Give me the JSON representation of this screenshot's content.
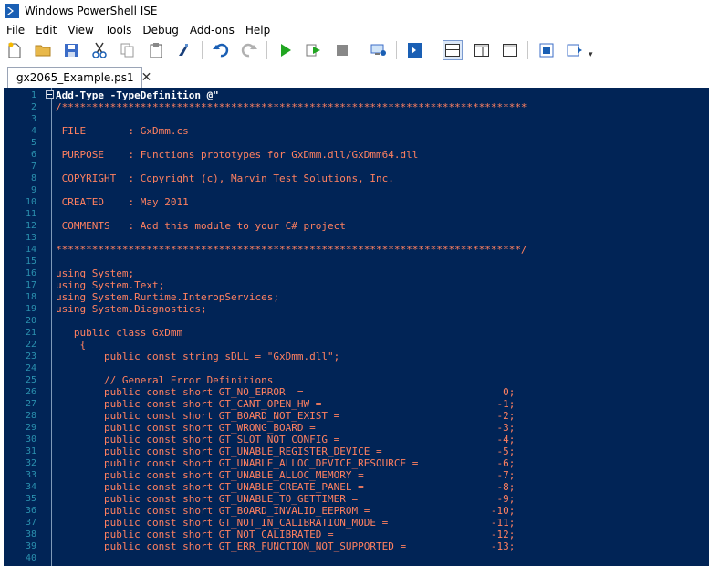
{
  "window": {
    "title": "Windows PowerShell ISE"
  },
  "menu": [
    "File",
    "Edit",
    "View",
    "Tools",
    "Debug",
    "Add-ons",
    "Help"
  ],
  "toolbar_icons": [
    "new-file-icon",
    "open-folder-icon",
    "save-icon",
    "cut-icon",
    "copy-icon",
    "paste-icon",
    "clear-console-icon",
    "undo-icon",
    "redo-icon",
    "run-script-icon",
    "run-selection-icon",
    "stop-icon",
    "new-remote-tab-icon",
    "start-powershell-icon",
    "show-script-pane-top-icon",
    "show-script-pane-right-icon",
    "show-script-pane-max-icon",
    "show-command-window-icon",
    "show-command-addon-icon"
  ],
  "tab": {
    "label": "gx2065_Example.ps1",
    "close": "✕"
  },
  "editor": {
    "lines": [
      "Add-Type -TypeDefinition @\"",
      "/*****************************************************************************",
      "",
      " FILE       : GxDmm.cs",
      "",
      " PURPOSE    : Functions prototypes for GxDmm.dll/GxDmm64.dll",
      "",
      " COPYRIGHT  : Copyright (c), Marvin Test Solutions, Inc.",
      "",
      " CREATED    : May 2011",
      "",
      " COMMENTS   : Add this module to your C# project",
      "",
      "*****************************************************************************/",
      "",
      "using System;",
      "using System.Text;",
      "using System.Runtime.InteropServices;",
      "using System.Diagnostics;",
      "",
      "   public class GxDmm",
      "    {",
      "        public const string sDLL = \"GxDmm.dll\";",
      "",
      "        // General Error Definitions",
      "        public const short GT_NO_ERROR  =                                 0;",
      "        public const short GT_CANT_OPEN_HW =                             -1;",
      "        public const short GT_BOARD_NOT_EXIST =                          -2;",
      "        public const short GT_WRONG_BOARD =                              -3;",
      "        public const short GT_SLOT_NOT_CONFIG =                          -4;",
      "        public const short GT_UNABLE_REGISTER_DEVICE =                   -5;",
      "        public const short GT_UNABLE_ALLOC_DEVICE_RESOURCE =             -6;",
      "        public const short GT_UNABLE_ALLOC_MEMORY =                      -7;",
      "        public const short GT_UNABLE_CREATE_PANEL =                      -8;",
      "        public const short GT_UNABLE_TO_GETTIMER =                       -9;",
      "        public const short GT_BOARD_INVALID_EEPROM =                    -10;",
      "        public const short GT_NOT_IN_CALIBRATION_MODE =                 -11;",
      "        public const short GT_NOT_CALIBRATED =                          -12;",
      "        public const short GT_ERR_FUNCTION_NOT_SUPPORTED =              -13;",
      ""
    ],
    "line_numbers": [
      "1",
      "2",
      "3",
      "4",
      "5",
      "6",
      "7",
      "8",
      "9",
      "10",
      "11",
      "12",
      "13",
      "14",
      "15",
      "16",
      "17",
      "18",
      "19",
      "20",
      "21",
      "22",
      "23",
      "24",
      "25",
      "26",
      "27",
      "28",
      "29",
      "30",
      "31",
      "32",
      "33",
      "34",
      "35",
      "36",
      "37",
      "38",
      "39",
      "40"
    ],
    "colors": {
      "background": "#012456",
      "text": "#ff8060",
      "line_number": "#2b91af"
    }
  }
}
